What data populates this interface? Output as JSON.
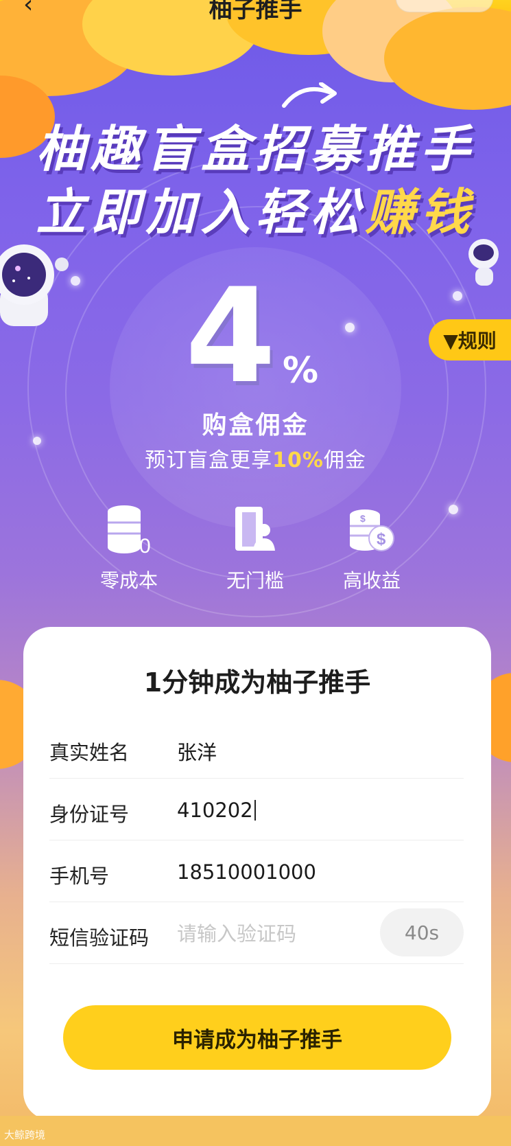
{
  "nav": {
    "back_icon": "‹",
    "title": "柚子推手"
  },
  "banner": {
    "line1": "柚趣盲盒招募推手",
    "line2_prefix": "立即加入轻松",
    "line2_highlight": "赚钱"
  },
  "rule_tab": {
    "label": "▼规则"
  },
  "commission": {
    "big_number": "4",
    "percent": "%",
    "label": "购盒佣金",
    "sub_prefix": "预订盲盒更享",
    "sub_highlight": "10%",
    "sub_suffix": "佣金"
  },
  "features": [
    {
      "icon": "coin-stack-icon",
      "label": "零成本"
    },
    {
      "icon": "door-person-icon",
      "label": "无门槛"
    },
    {
      "icon": "money-coins-icon",
      "label": "高收益"
    }
  ],
  "form": {
    "title": "1分钟成为柚子推手",
    "fields": [
      {
        "label": "真实姓名",
        "value": "张洋"
      },
      {
        "label": "身份证号",
        "value": "410202"
      },
      {
        "label": "手机号",
        "value": "18510001000"
      },
      {
        "label": "短信验证码",
        "value": "",
        "placeholder": "请输入验证码"
      }
    ],
    "code_button": "40s",
    "submit_label": "申请成为柚子推手"
  },
  "watermark": "大鲸跨境",
  "colors": {
    "accent": "#ffcf1c",
    "highlight": "#ffd84a",
    "bg_top": "#6e5ae8"
  }
}
